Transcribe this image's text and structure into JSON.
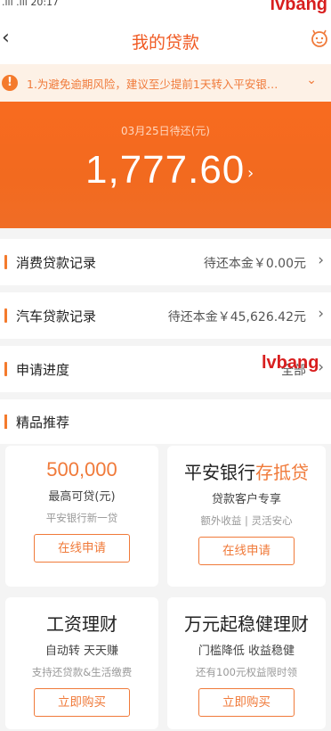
{
  "status_bar": {
    "time": ".ııl .ııl 20:17",
    "right": "⊙"
  },
  "watermark": "lvbang",
  "header": {
    "title": "我的贷款",
    "back_icon": "chevron-left-icon",
    "service_icon": "face-service-icon"
  },
  "notice": {
    "text": "1.为避免逾期风险，建议至少提前1天转入平安银…"
  },
  "summary": {
    "due_label": "03月25日待还(元)",
    "amount": "1,777.60"
  },
  "loans": [
    {
      "label": "消费贷款记录",
      "value": "待还本金￥0.00元"
    },
    {
      "label": "汽车贷款记录",
      "value": "待还本金￥45,626.42元"
    },
    {
      "label": "申请进度",
      "value": "全部"
    }
  ],
  "recommend": {
    "title": "精品推荐",
    "cards": [
      {
        "title": "500,000",
        "sub": "最高可贷(元)",
        "desc": "平安银行新一贷",
        "button": "在线申请"
      },
      {
        "title_prefix": "平安银行",
        "title_highlight": "存抵贷",
        "sub": "贷款客户专享",
        "desc": "额外收益 | 灵活安心",
        "button": "在线申请"
      },
      {
        "title": "工资理财",
        "sub": "自动转 天天赚",
        "desc": "支持还贷款&生活缴费",
        "button": "立即购买"
      },
      {
        "title": "万元起稳健理财",
        "sub": "门槛降低 收益稳健",
        "desc": "还有100元权益限时领",
        "button": "立即购买"
      }
    ]
  },
  "colors": {
    "accent": "#f47a2c",
    "hero": "#f86b1f",
    "watermark": "#d81e1e"
  }
}
